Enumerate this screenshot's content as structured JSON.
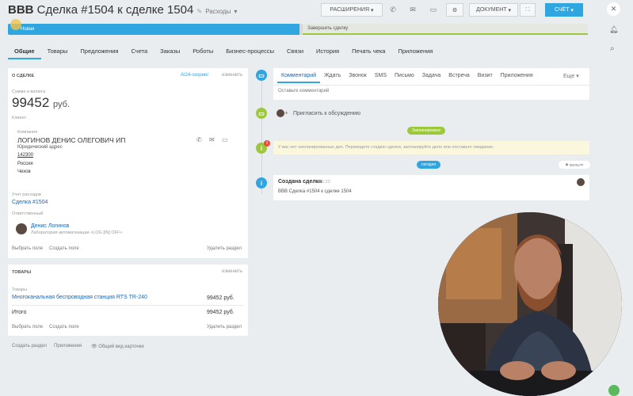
{
  "header": {
    "title_prefix": "BBB",
    "title": "Сделка #1504 к сделке 1504",
    "category": "Расходы",
    "btn_extend": "РАСШИРЕНИЯ",
    "btn_document": "ДОКУМЕНТ",
    "btn_account": "СЧЁТ"
  },
  "pipeline": {
    "stage_current": "Новая",
    "stage_finish": "Завершить сделку"
  },
  "tabs": [
    "Общие",
    "Товары",
    "Предложения",
    "Счета",
    "Заказы",
    "Роботы",
    "Бизнес-процессы",
    "Связи",
    "История",
    "Печать чека",
    "Приложения"
  ],
  "about": {
    "heading": "О СДЕЛКЕ",
    "scoring": "AI24-скоринг",
    "edit": "изменить",
    "amount_label": "Сумма и валюта",
    "amount": "99452",
    "currency": "руб.",
    "client_label": "Клиент",
    "company_label": "Компания",
    "company": "ЛОГИНОВ ДЕНИС ОЛЕГОВИЧ ИП",
    "addr_label": "Юридический адрес",
    "zip": "142300",
    "country": "Россия",
    "city": "Чехов",
    "expense_label": "Учет расходов",
    "deal_link": "Сделка #1504",
    "resp_label": "Ответственный",
    "resp_name": "Денис Логинов",
    "resp_role": "Лаборатория автоматизации «LOG [IN] OFF»",
    "choose_field": "Выбрать поле",
    "create_field": "Создать поле",
    "delete_section": "Удалить раздел"
  },
  "goods": {
    "heading": "ТОВАРЫ",
    "edit": "изменить",
    "col_label": "Товары",
    "item": "Многоканальная беспроводная станция RTS TR-240",
    "item_price": "99452 руб.",
    "total_label": "Итого",
    "total": "99452 руб.",
    "choose_field": "Выбрать поле",
    "create_field": "Создать поле",
    "delete_section": "Удалить раздел"
  },
  "footer": {
    "create_section": "Создать раздел",
    "apps": "Приложения",
    "common_view": "Общий вид карточки"
  },
  "feed": {
    "tabs": [
      "Комментарий",
      "Ждать",
      "Звонок",
      "SMS",
      "Письмо",
      "Задача",
      "Встреча",
      "Визит",
      "Приложения"
    ],
    "more": "Еще",
    "comment_placeholder": "Оставьте комментарий",
    "invite": "Пригласить к обсуждению",
    "planned": "Запланировано",
    "warning": "У вас нет запланированных дел. Переводите стадию сделки, запланируйте дело или поставьте ожидание.",
    "today": "сегодня",
    "filter": "ФИЛЬТР",
    "created_title": "Создана сделка",
    "created_time": "16:23",
    "created_desc": "BBB Сделка #1504 к сделке 1504",
    "badge": "1"
  },
  "colors": {
    "accent": "#2fa6e0",
    "green": "#9ec83b",
    "link": "#2067b0"
  }
}
